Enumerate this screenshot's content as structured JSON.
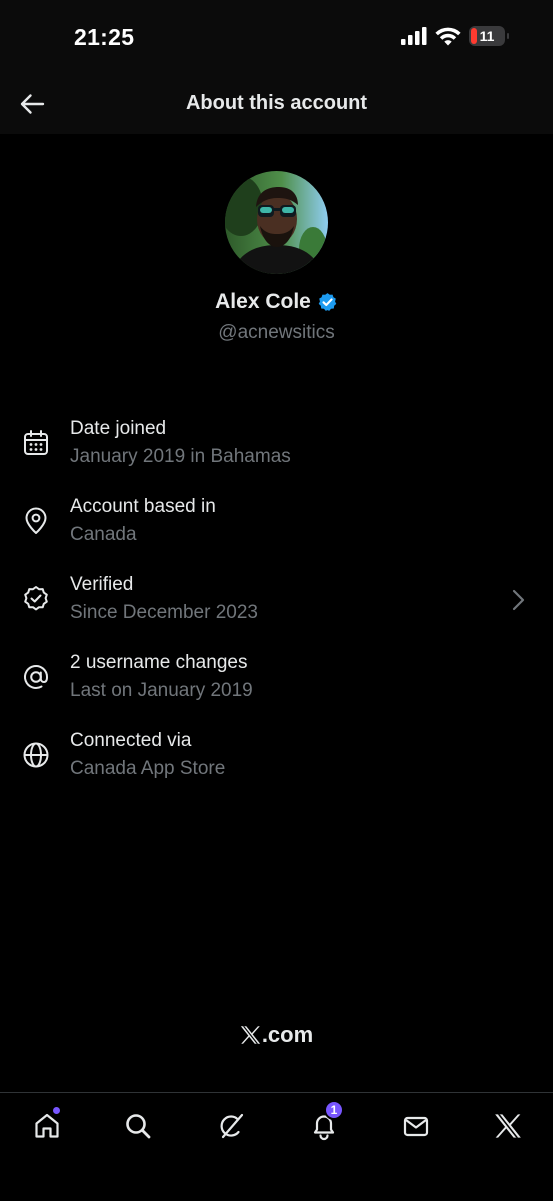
{
  "status_bar": {
    "time": "21:25",
    "battery_level": "11",
    "signal_icon": "cellular-signal-icon",
    "wifi_icon": "wifi-icon"
  },
  "header": {
    "title": "About this account",
    "back_icon": "arrow-left-icon"
  },
  "profile": {
    "name": "Alex Cole",
    "handle": "@acnewsitics",
    "verified": true,
    "verified_color": "#1d9bf0"
  },
  "info_rows": [
    {
      "icon": "calendar-icon",
      "title": "Date joined",
      "subtitle": "January 2019 in Bahamas"
    },
    {
      "icon": "location-pin-icon",
      "title": "Account based in",
      "subtitle": "Canada"
    },
    {
      "icon": "verified-badge-icon",
      "title": "Verified",
      "subtitle": "Since December 2023",
      "has_chevron": true
    },
    {
      "icon": "at-sign-icon",
      "title": "2 username changes",
      "subtitle": "Last on January 2019"
    },
    {
      "icon": "globe-icon",
      "title": "Connected via",
      "subtitle": "Canada App Store"
    }
  ],
  "footer": {
    "logo_text": ".com"
  },
  "tab_bar": {
    "tabs": [
      {
        "icon": "home-icon",
        "has_dot": true
      },
      {
        "icon": "search-icon"
      },
      {
        "icon": "grok-icon"
      },
      {
        "icon": "bell-icon",
        "badge": "1"
      },
      {
        "icon": "mail-icon"
      },
      {
        "icon": "x-logo-icon"
      }
    ],
    "accent_color": "#7856ff"
  },
  "colors": {
    "background": "#000000",
    "text_primary": "#e7e9ea",
    "text_secondary": "#71767b"
  }
}
